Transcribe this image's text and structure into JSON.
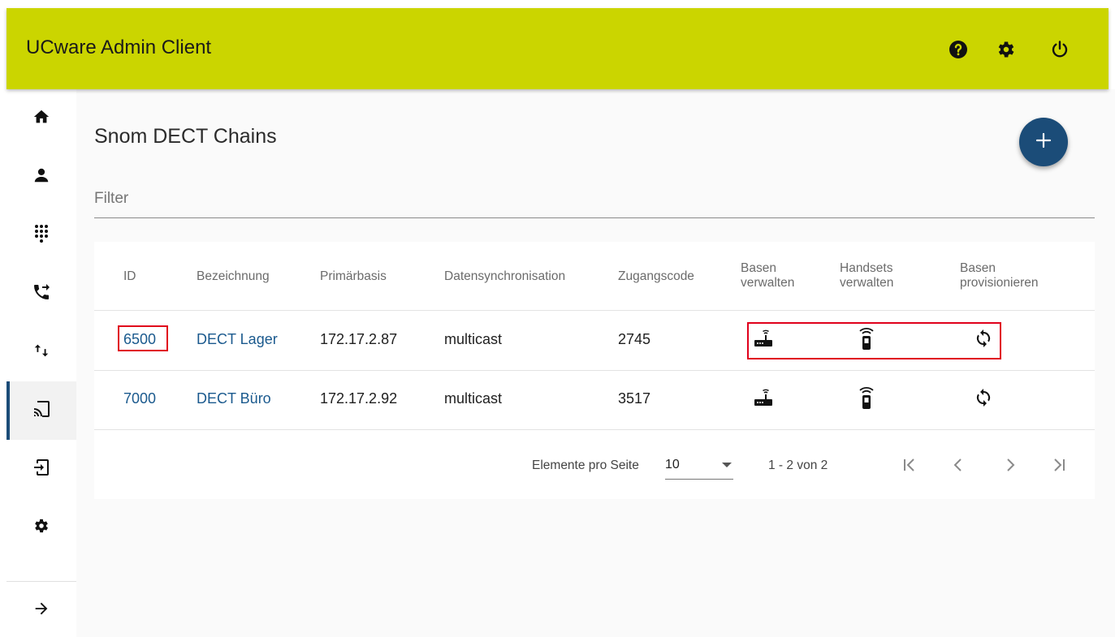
{
  "app": {
    "title": "UCware Admin Client"
  },
  "topbar": {
    "icons": [
      "help-icon",
      "settings-icon",
      "power-icon"
    ]
  },
  "sidebar": {
    "items": [
      {
        "name": "home",
        "icon": "home-icon"
      },
      {
        "name": "users",
        "icon": "person-icon"
      },
      {
        "name": "dialpad",
        "icon": "dialpad-icon"
      },
      {
        "name": "call-forward",
        "icon": "phone-forward-icon"
      },
      {
        "name": "transfer",
        "icon": "swap-arrows-icon"
      },
      {
        "name": "dect-chains",
        "icon": "cast-icon",
        "active": true
      },
      {
        "name": "provisioning",
        "icon": "device-login-icon"
      },
      {
        "name": "settings",
        "icon": "gear-icon"
      }
    ],
    "collapse_icon": "arrow-right-icon"
  },
  "page": {
    "title": "Snom DECT Chains",
    "filter_placeholder": "Filter"
  },
  "table": {
    "headers": {
      "id": "ID",
      "name": "Bezeichnung",
      "primary": "Primärbasis",
      "sync": "Datensynchronisation",
      "code": "Zugangscode",
      "bases_1": "Basen",
      "bases_2": "verwalten",
      "handsets_1": "Handsets",
      "handsets_2": "verwalten",
      "prov_1": "Basen",
      "prov_2": "provisionieren"
    },
    "rows": [
      {
        "id": "6500",
        "name": "DECT Lager",
        "primary": "172.17.2.87",
        "sync": "multicast",
        "code": "2745"
      },
      {
        "id": "7000",
        "name": "DECT Büro",
        "primary": "172.17.2.92",
        "sync": "multicast",
        "code": "3517"
      }
    ],
    "action_icons": [
      "router-icon",
      "handset-icon",
      "sync-icon"
    ]
  },
  "pager": {
    "items_per_page_label": "Elemente pro Seite",
    "items_per_page_value": "10",
    "range_label": "1 - 2 von 2"
  },
  "colors": {
    "topbar": "#cbd500",
    "accent": "#1b4c78",
    "link": "#1b5a8e",
    "highlight": "#e0001b"
  }
}
